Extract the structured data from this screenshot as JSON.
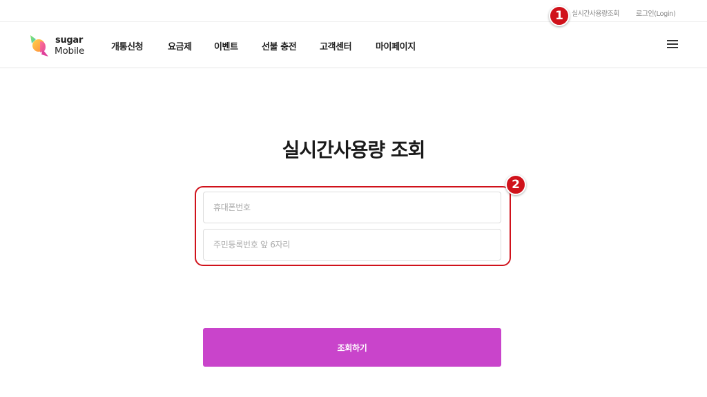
{
  "top_links": {
    "usage": "실시간사용량조회",
    "login": "로그인(Login)"
  },
  "annotations": {
    "badge_1": "1",
    "badge_2": "2",
    "highlight_color": "#d0121b"
  },
  "logo": {
    "line1": "sugar",
    "line2": "Mobile",
    "icon": "candy-icon"
  },
  "nav": {
    "items": [
      "개통신청",
      "요금제",
      "이벤트",
      "선불 충전",
      "고객센터",
      "마이페이지"
    ],
    "menu_icon": "hamburger-menu-icon"
  },
  "main": {
    "title": "실시간사용량 조회",
    "phone_placeholder": "휴대폰번호",
    "id_placeholder": "주민등록번호 앞 6자리",
    "phone_value": "",
    "id_value": "",
    "submit_label": "조회하기"
  },
  "colors": {
    "accent": "#c944cb",
    "annotation": "#d0121b"
  }
}
